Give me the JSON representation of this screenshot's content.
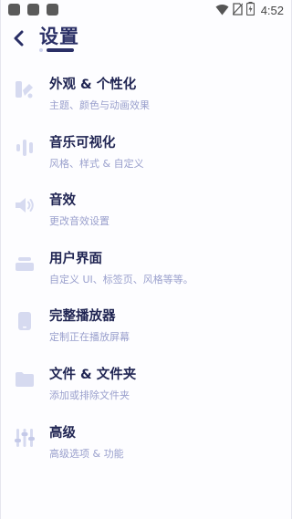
{
  "status_bar": {
    "time": "4:52",
    "icons": [
      "app-icon",
      "app-icon",
      "app-icon",
      "wifi-icon",
      "no-sim-icon",
      "battery-charging-icon"
    ]
  },
  "header": {
    "title": "设置",
    "back_icon": "chevron-left-icon"
  },
  "colors": {
    "accent": "#2a2f66",
    "title_text": "#1f2452",
    "subtitle_text": "#9aa0cd",
    "icon_tint": "#d6daf0"
  },
  "settings": [
    {
      "icon": "palette-icon",
      "title": "外观 & 个性化",
      "subtitle": "主题、颜色与动画效果"
    },
    {
      "icon": "visualizer-bars-icon",
      "title": "音乐可视化",
      "subtitle": "风格、样式 & 自定义"
    },
    {
      "icon": "speaker-icon",
      "title": "音效",
      "subtitle": "更改音效设置"
    },
    {
      "icon": "layout-icon",
      "title": "用户界面",
      "subtitle": "自定义 UI、标签页、风格等等。"
    },
    {
      "icon": "phone-icon",
      "title": "完整播放器",
      "subtitle": "定制正在播放屏幕"
    },
    {
      "icon": "folder-icon",
      "title": "文件 & 文件夹",
      "subtitle": "添加或排除文件夹"
    },
    {
      "icon": "sliders-icon",
      "title": "高级",
      "subtitle": "高级选项 & 功能"
    }
  ]
}
